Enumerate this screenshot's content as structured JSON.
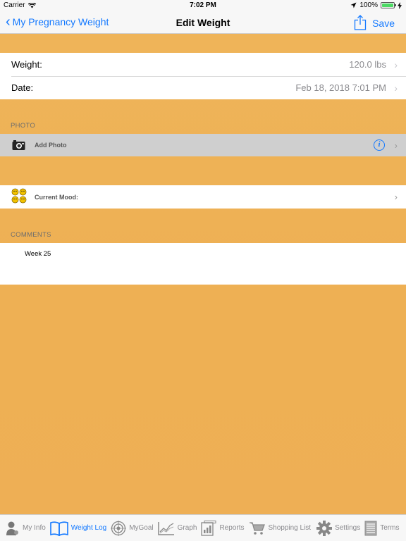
{
  "status": {
    "carrier": "Carrier",
    "time": "7:02 PM",
    "battery": "100%"
  },
  "nav": {
    "back_label": "My Pregnancy Weight",
    "title": "Edit Weight",
    "save_label": "Save"
  },
  "form": {
    "weight_label": "Weight:",
    "weight_value": "120.0 lbs",
    "date_label": "Date:",
    "date_value": "Feb 18, 2018 7:01 PM"
  },
  "photo": {
    "section_title": "PHOTO",
    "add_label": "Add Photo"
  },
  "mood": {
    "label": "Current Mood:"
  },
  "comments": {
    "section_title": "COMMENTS",
    "text": "Week 25"
  },
  "tabs": [
    {
      "label": "My Info",
      "icon": "person-icon"
    },
    {
      "label": "Weight Log",
      "icon": "book-icon"
    },
    {
      "label": "MyGoal",
      "icon": "target-icon"
    },
    {
      "label": "Graph",
      "icon": "graph-icon"
    },
    {
      "label": "Reports",
      "icon": "reports-icon"
    },
    {
      "label": "Shopping List",
      "icon": "cart-icon"
    },
    {
      "label": "Settings",
      "icon": "gear-icon"
    },
    {
      "label": "Terms",
      "icon": "document-icon"
    }
  ],
  "colors": {
    "accent": "#1479ff",
    "background": "#eeb055",
    "active_tab": "#1479ff"
  }
}
